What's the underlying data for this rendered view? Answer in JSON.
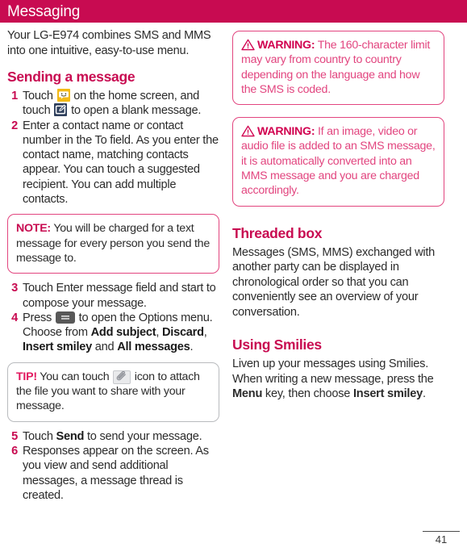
{
  "header": {
    "title": "Messaging",
    "bar_color": "#c80b51"
  },
  "left_column": {
    "intro": "Your LG-E974 combines SMS and MMS into one intuitive, easy-to-use menu.",
    "section_heading": "Sending a message",
    "steps": [
      {
        "number": "1",
        "text_before_icon1": "Touch ",
        "text_after_icon1": " on the home screen, and touch ",
        "text_after_icon2": " to open a blank message."
      },
      {
        "number": "2",
        "text": "Enter a contact name or contact number in the To field. As you enter the contact name, matching contacts appear. You can touch a suggested recipient. You can add multiple contacts."
      },
      {
        "number": "3",
        "text": "Touch Enter message field and start to compose your message."
      },
      {
        "number": "4",
        "text_before_icon": "Press ",
        "text_after_icon": " to open the Options menu. Choose from ",
        "bold_1": "Add subject",
        "sep_1": ", ",
        "bold_2": "Discard",
        "sep_2": ", ",
        "bold_3": "Insert smiley",
        "sep_3": " and ",
        "bold_4": "All messages",
        "sep_4": "."
      },
      {
        "number": "5",
        "text_before_bold": "Touch ",
        "bold": "Send",
        "text_after_bold": " to send your message."
      },
      {
        "number": "6",
        "text": "Responses appear on the screen. As you view and send additional messages, a message thread is created."
      }
    ],
    "note_box": {
      "label": "NOTE:",
      "text": " You will be charged for a text message for every person you send the message to."
    },
    "tip_box": {
      "label": "TIP!",
      "text_before_icon": " You can touch ",
      "text_after_icon": " icon to attach the file you want to share with your message."
    }
  },
  "right_column": {
    "warning_1": {
      "label": "WARNING:",
      "text": " The 160-character limit may vary from country to country depending on the language and how the SMS is coded."
    },
    "warning_2": {
      "label": "WARNING:",
      "text": " If an image, video or audio file is added to an SMS message, it is automatically converted into an MMS message and you are charged accordingly."
    },
    "threaded_heading": "Threaded box",
    "threaded_text": "Messages (SMS, MMS) exchanged with another party can be displayed in chronological order so that you can conveniently see an overview of your conversation.",
    "smilies_heading": "Using Smilies",
    "smilies_text_1": "Liven up your messages using Smilies. When writing a new message, press the ",
    "smilies_bold_1": "Menu",
    "smilies_text_2": " key, then choose ",
    "smilies_bold_2": "Insert smiley",
    "smilies_text_3": "."
  },
  "footer": {
    "page_number": "41"
  },
  "icons": {
    "messaging_app": "messaging-smiley-icon",
    "compose": "compose-message-icon",
    "options_menu": "hamburger-menu-icon",
    "attach": "paperclip-icon",
    "warning": "warning-triangle-icon"
  },
  "colors": {
    "brand_crimson": "#c80b51",
    "warning_pink": "#e2457f",
    "body_text": "#2b2b2b"
  }
}
